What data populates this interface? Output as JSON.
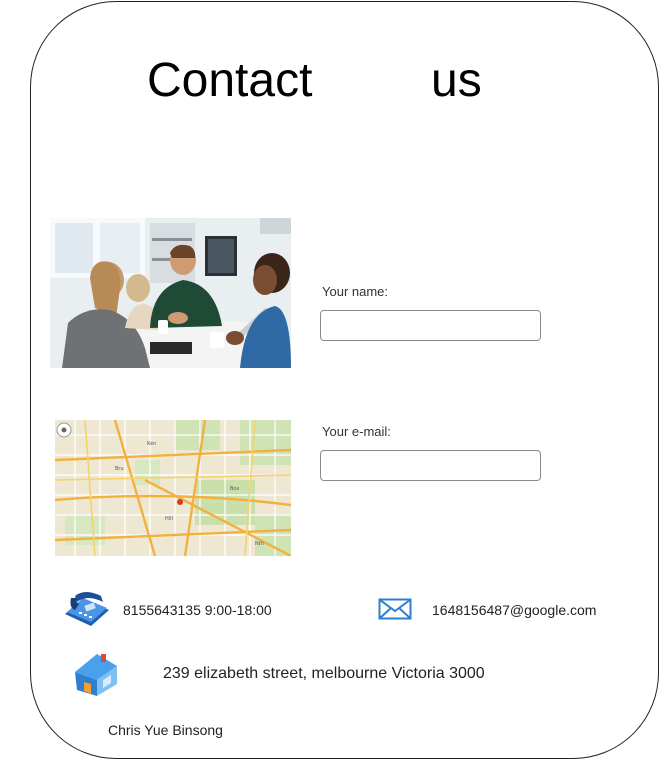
{
  "header": {
    "title_word1": "Contact",
    "title_word2": "us"
  },
  "form": {
    "name_label": "Your name:",
    "name_value": "",
    "email_label": "Your e-mail:",
    "email_value": ""
  },
  "contact": {
    "phone": "8155643135  9:00-18:00",
    "email": "1648156487@google.com",
    "address": "239 elizabeth street, melbourne Victoria 3000"
  },
  "footer": {
    "author": "Chris Yue Binsong"
  },
  "icons": {
    "phone": "telephone-icon",
    "mail": "envelope-icon",
    "home": "house-icon"
  },
  "colors": {
    "accent_blue": "#2f7fd1",
    "house_roof": "#3a8de0",
    "house_door": "#f0a030"
  }
}
